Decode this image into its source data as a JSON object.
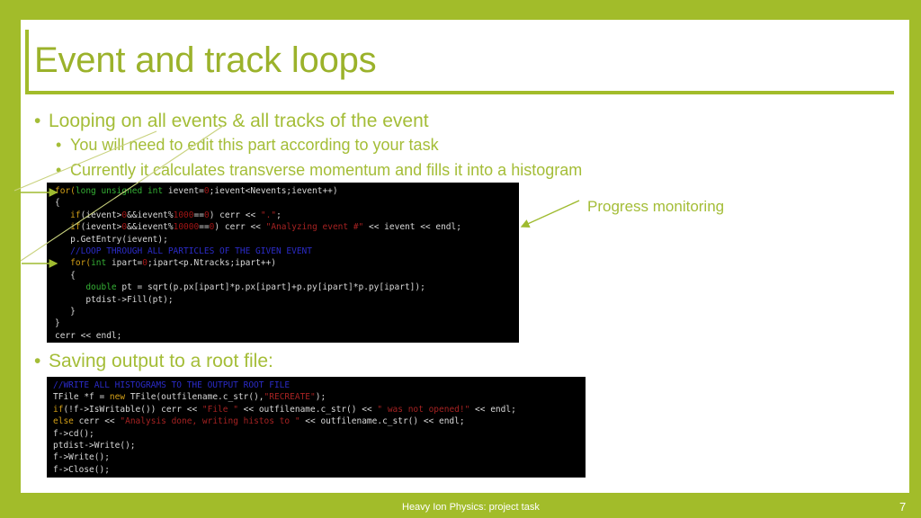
{
  "slide": {
    "title": "Event and track loops",
    "accent_color": "#a2bc2a",
    "text_color": "#a4bd37",
    "code_background": "#000000"
  },
  "bullets": {
    "marker": "•",
    "loop": "Looping on all events & all tracks of the event",
    "edit": "You will need to edit this part according to your task",
    "currently": "Currently it calculates transverse momentum and fills it into a histogram",
    "saving": "Saving output to a root file:"
  },
  "annotations": {
    "progress_monitoring": "Progress monitoring"
  },
  "code_event_loop": {
    "lines": [
      [
        {
          "t": "for(",
          "c": "kwo"
        },
        {
          "t": "long unsigned int",
          "c": "kw"
        },
        {
          "t": " ievent=",
          "c": "pl"
        },
        {
          "t": "0",
          "c": "num"
        },
        {
          "t": ";ievent<Nevents;ievent++)",
          "c": "pl"
        }
      ],
      [
        {
          "t": "{",
          "c": "pl"
        }
      ],
      [
        {
          "t": "   ",
          "c": "pl"
        },
        {
          "t": "if",
          "c": "kwo"
        },
        {
          "t": "(ievent>",
          "c": "pl"
        },
        {
          "t": "0",
          "c": "num"
        },
        {
          "t": "&&ievent%",
          "c": "pl"
        },
        {
          "t": "1000",
          "c": "num"
        },
        {
          "t": "==",
          "c": "pl"
        },
        {
          "t": "0",
          "c": "num"
        },
        {
          "t": ") cerr << ",
          "c": "pl"
        },
        {
          "t": "\".\"",
          "c": "str"
        },
        {
          "t": ";",
          "c": "pl"
        }
      ],
      [
        {
          "t": "   ",
          "c": "pl"
        },
        {
          "t": "if",
          "c": "kwo"
        },
        {
          "t": "(ievent>",
          "c": "pl"
        },
        {
          "t": "0",
          "c": "num"
        },
        {
          "t": "&&ievent%",
          "c": "pl"
        },
        {
          "t": "10000",
          "c": "num"
        },
        {
          "t": "==",
          "c": "pl"
        },
        {
          "t": "0",
          "c": "num"
        },
        {
          "t": ") cerr << ",
          "c": "pl"
        },
        {
          "t": "\"Analyzing event #\"",
          "c": "str"
        },
        {
          "t": " << ievent << endl;",
          "c": "pl"
        }
      ],
      [
        {
          "t": "   p.GetEntry(ievent);",
          "c": "pl"
        }
      ],
      [
        {
          "t": "   //LOOP THROUGH ALL PARTICLES OF THE GIVEN EVENT",
          "c": "cmt"
        }
      ],
      [
        {
          "t": "   ",
          "c": "pl"
        },
        {
          "t": "for(",
          "c": "kwo"
        },
        {
          "t": "int",
          "c": "kw"
        },
        {
          "t": " ipart=",
          "c": "pl"
        },
        {
          "t": "0",
          "c": "num"
        },
        {
          "t": ";ipart<p.Ntracks;ipart++)",
          "c": "pl"
        }
      ],
      [
        {
          "t": "   {",
          "c": "pl"
        }
      ],
      [
        {
          "t": "      ",
          "c": "pl"
        },
        {
          "t": "double",
          "c": "kw"
        },
        {
          "t": " pt = sqrt(p.px[ipart]*p.px[ipart]+p.py[ipart]*p.py[ipart]);",
          "c": "pl"
        }
      ],
      [
        {
          "t": "      ptdist->Fill(pt);",
          "c": "pl"
        }
      ],
      [
        {
          "t": "   }",
          "c": "pl"
        }
      ],
      [
        {
          "t": "}",
          "c": "pl"
        }
      ],
      [
        {
          "t": "cerr << endl;",
          "c": "pl"
        }
      ]
    ]
  },
  "code_save_root": {
    "lines": [
      [
        {
          "t": "//WRITE ALL HISTOGRAMS TO THE OUTPUT ROOT FILE",
          "c": "cmt"
        }
      ],
      [
        {
          "t": "TFile *f = ",
          "c": "pl"
        },
        {
          "t": "new",
          "c": "knew"
        },
        {
          "t": " TFile(outfilename.c_str(),",
          "c": "pl"
        },
        {
          "t": "\"RECREATE\"",
          "c": "str"
        },
        {
          "t": ");",
          "c": "pl"
        }
      ],
      [
        {
          "t": "if",
          "c": "kwo"
        },
        {
          "t": "(!f->IsWritable()) cerr << ",
          "c": "pl"
        },
        {
          "t": "\"File \"",
          "c": "str"
        },
        {
          "t": " << outfilename.c_str() << ",
          "c": "pl"
        },
        {
          "t": "\" was not opened!\"",
          "c": "str"
        },
        {
          "t": " << endl;",
          "c": "pl"
        }
      ],
      [
        {
          "t": "else",
          "c": "kwo"
        },
        {
          "t": " cerr << ",
          "c": "pl"
        },
        {
          "t": "\"Analysis done, writing histos to \"",
          "c": "str"
        },
        {
          "t": " << outfilename.c_str() << endl;",
          "c": "pl"
        }
      ],
      [
        {
          "t": "f->cd();",
          "c": "pl"
        }
      ],
      [
        {
          "t": "ptdist->Write();",
          "c": "pl"
        }
      ],
      [
        {
          "t": "f->Write();",
          "c": "pl"
        }
      ],
      [
        {
          "t": "f->Close();",
          "c": "pl"
        }
      ]
    ]
  },
  "footer": {
    "text": "Heavy Ion Physics: project task",
    "page_number": "7"
  }
}
